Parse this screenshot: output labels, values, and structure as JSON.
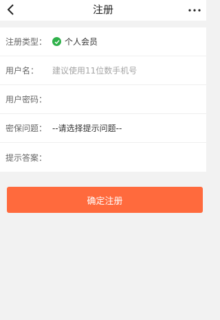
{
  "header": {
    "title": "注册",
    "back_icon": "chevron-left-icon",
    "more_icon": "ellipsis-icon"
  },
  "form": {
    "register_type": {
      "label": "注册类型：",
      "value": "个人会员",
      "icon": "check-circle-icon",
      "icon_color": "#2fb14a"
    },
    "username": {
      "label": "用户名：",
      "placeholder": "建议使用11位数手机号"
    },
    "password": {
      "label": "用户密码：",
      "placeholder": ""
    },
    "security_question": {
      "label": "密保问题：",
      "value": "--请选择提示问题--"
    },
    "answer": {
      "label": "提示答案：",
      "placeholder": ""
    }
  },
  "submit": {
    "label": "确定注册",
    "color": "#ff6a3d"
  }
}
